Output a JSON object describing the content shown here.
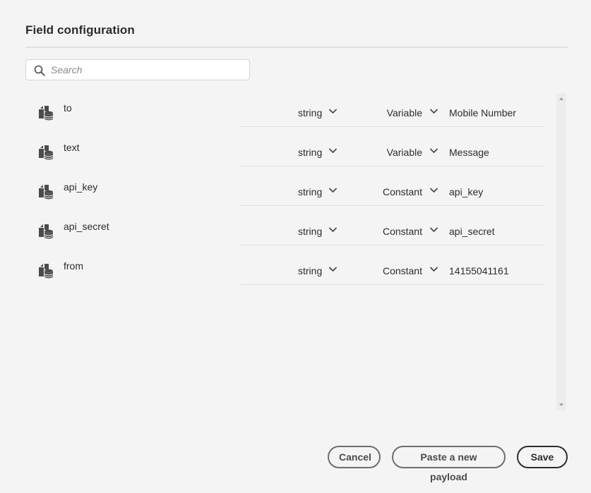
{
  "dialog": {
    "title": "Field configuration"
  },
  "search": {
    "placeholder": "Search",
    "value": ""
  },
  "fields": [
    {
      "name": "to",
      "type": "string",
      "mode": "Variable",
      "value": "Mobile Number"
    },
    {
      "name": "text",
      "type": "string",
      "mode": "Variable",
      "value": "Message"
    },
    {
      "name": "api_key",
      "type": "string",
      "mode": "Constant",
      "value": "api_key"
    },
    {
      "name": "api_secret",
      "type": "string",
      "mode": "Constant",
      "value": "api_secret"
    },
    {
      "name": "from",
      "type": "string",
      "mode": "Constant",
      "value": "14155041161"
    }
  ],
  "icons": {
    "search": "search-icon",
    "field": "field-source-icon",
    "dropdown": "chevron-down-icon",
    "scroll_up": "scroll-up-arrow-icon",
    "scroll_down": "scroll-down-arrow-icon"
  },
  "footer": {
    "cancel_label": "Cancel",
    "paste_label": "Paste a new payload",
    "save_label": "Save"
  },
  "colors": {
    "background": "#f4f4f4",
    "text": "#2c2c2c",
    "icon": "#4b4b4b",
    "divider": "#e1e1e1"
  }
}
